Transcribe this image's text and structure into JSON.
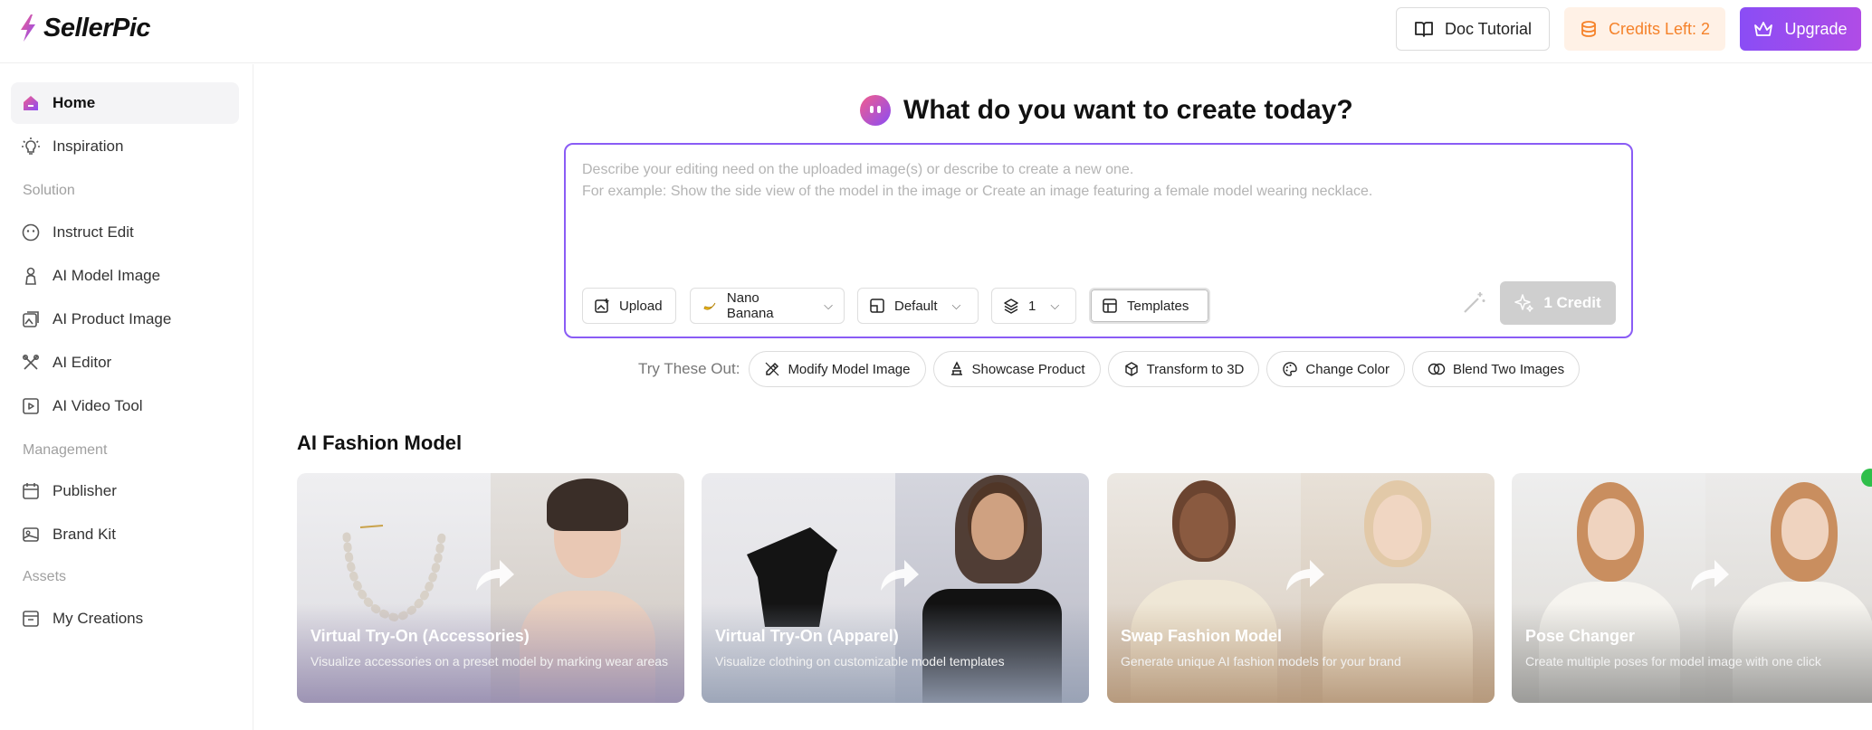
{
  "brand": {
    "name": "SellerPic"
  },
  "header": {
    "doc_tutorial": "Doc Tutorial",
    "credits_left": "Credits Left: 2",
    "upgrade": "Upgrade"
  },
  "sidebar": {
    "items": [
      {
        "label": "Home",
        "icon": "home-icon",
        "active": true
      },
      {
        "label": "Inspiration",
        "icon": "lightbulb-icon"
      }
    ],
    "solution_label": "Solution",
    "solution_items": [
      {
        "label": "Instruct Edit",
        "icon": "face-icon"
      },
      {
        "label": "AI Model Image",
        "icon": "model-icon"
      },
      {
        "label": "AI Product Image",
        "icon": "product-icon"
      },
      {
        "label": "AI Editor",
        "icon": "editor-icon"
      },
      {
        "label": "AI Video Tool",
        "icon": "video-icon"
      }
    ],
    "management_label": "Management",
    "management_items": [
      {
        "label": "Publisher",
        "icon": "calendar-icon"
      },
      {
        "label": "Brand Kit",
        "icon": "palette-icon"
      }
    ],
    "assets_label": "Assets",
    "assets_items": [
      {
        "label": "My Creations",
        "icon": "archive-icon"
      }
    ]
  },
  "main": {
    "title": "What do you want to create today?",
    "prompt": {
      "placeholder_line1": "Describe your editing need on the uploaded image(s) or describe to create a new one.",
      "placeholder_line2": "For example: Show the side view of the model in the image or Create an image featuring a female model wearing necklace."
    },
    "tools": {
      "upload": "Upload",
      "model": "Nano Banana",
      "ratio": "Default",
      "count": "1",
      "templates": "Templates",
      "credit_button": "1 Credit"
    },
    "try_label": "Try These Out:",
    "try_chips": [
      {
        "label": "Modify Model Image",
        "icon": "edit-icon"
      },
      {
        "label": "Showcase Product",
        "icon": "stand-icon"
      },
      {
        "label": "Transform to 3D",
        "icon": "cube-icon"
      },
      {
        "label": "Change Color",
        "icon": "palette-icon"
      },
      {
        "label": "Blend Two Images",
        "icon": "blend-icon"
      }
    ],
    "section_title": "AI Fashion Model",
    "cards": [
      {
        "title": "Virtual Try-On (Accessories)",
        "desc": "Visualize accessories on a preset model by marking wear areas"
      },
      {
        "title": "Virtual Try-On (Apparel)",
        "desc": "Visualize clothing on customizable model templates"
      },
      {
        "title": "Swap Fashion Model",
        "desc": "Generate unique AI fashion models for your brand"
      },
      {
        "title": "Pose Changer",
        "desc": "Create multiple poses for model image with one click"
      }
    ]
  },
  "colors": {
    "accent": "#8a5cf5",
    "upgrade_gradient_start": "#8a4df5",
    "upgrade_gradient_end": "#b04ce6",
    "credits_text": "#f5822a",
    "credits_bg": "#fff1e6"
  }
}
